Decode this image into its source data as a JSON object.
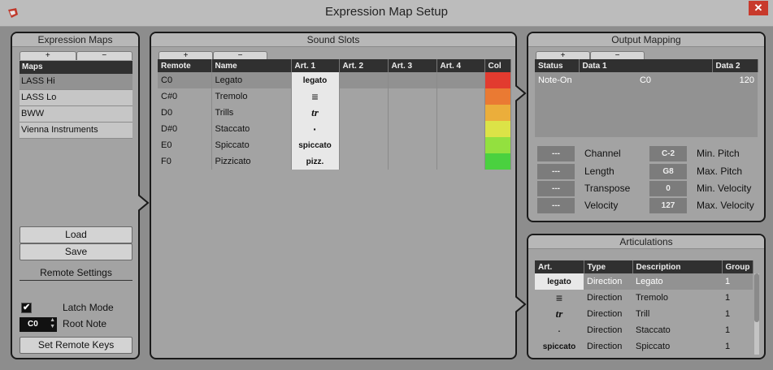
{
  "window": {
    "title": "Expression Map Setup",
    "close_label": "✕"
  },
  "expression_maps": {
    "title": "Expression Maps",
    "add_label": "+",
    "remove_label": "−",
    "header": "Maps",
    "items": [
      "LASS Hi",
      "LASS Lo",
      "BWW",
      "Vienna Instruments"
    ],
    "load_label": "Load",
    "save_label": "Save",
    "remote_settings_label": "Remote Settings",
    "latch_mode_label": "Latch Mode",
    "root_note_label": "Root Note",
    "root_note_value": "C0",
    "set_remote_keys_label": "Set Remote Keys"
  },
  "sound_slots": {
    "title": "Sound Slots",
    "add_label": "+",
    "remove_label": "−",
    "columns": [
      "Remote",
      "Name",
      "Art. 1",
      "Art. 2",
      "Art. 3",
      "Art. 4",
      "Col"
    ],
    "rows": [
      {
        "remote": "C0",
        "name": "Legato",
        "art1": "legato",
        "color": "#e23b2f"
      },
      {
        "remote": "C#0",
        "name": "Tremolo",
        "art1": "≡",
        "color": "#ea7a33"
      },
      {
        "remote": "D0",
        "name": "Trills",
        "art1": "tr",
        "color": "#ebae3b"
      },
      {
        "remote": "D#0",
        "name": "Staccato",
        "art1": "·",
        "color": "#dce347"
      },
      {
        "remote": "E0",
        "name": "Spiccato",
        "art1": "spiccato",
        "color": "#93e03f"
      },
      {
        "remote": "F0",
        "name": "Pizzicato",
        "art1": "pizz.",
        "color": "#4ad13f"
      }
    ]
  },
  "output_mapping": {
    "title": "Output Mapping",
    "add_label": "+",
    "remove_label": "−",
    "columns": [
      "Status",
      "Data 1",
      "Data 2"
    ],
    "rows": [
      {
        "status": "Note-On",
        "data1": "C0",
        "data2": "120"
      }
    ],
    "channel_label": "Channel",
    "channel_value": "---",
    "length_label": "Length",
    "length_value": "---",
    "transpose_label": "Transpose",
    "transpose_value": "---",
    "velocity_label": "Velocity",
    "velocity_value": "---",
    "min_pitch_label": "Min. Pitch",
    "min_pitch_value": "C-2",
    "max_pitch_label": "Max. Pitch",
    "max_pitch_value": "G8",
    "min_velocity_label": "Min. Velocity",
    "min_velocity_value": "0",
    "max_velocity_label": "Max. Velocity",
    "max_velocity_value": "127"
  },
  "articulations": {
    "title": "Articulations",
    "columns": [
      "Art.",
      "Type",
      "Description",
      "Group"
    ],
    "rows": [
      {
        "art": "legato",
        "type": "Direction",
        "description": "Legato",
        "group": "1"
      },
      {
        "art": "≡",
        "type": "Direction",
        "description": "Tremolo",
        "group": "1"
      },
      {
        "art": "tr",
        "type": "Direction",
        "description": "Trill",
        "group": "1"
      },
      {
        "art": "·",
        "type": "Direction",
        "description": "Staccato",
        "group": "1"
      },
      {
        "art": "spiccato",
        "type": "Direction",
        "description": "Spiccato",
        "group": "1"
      }
    ]
  }
}
